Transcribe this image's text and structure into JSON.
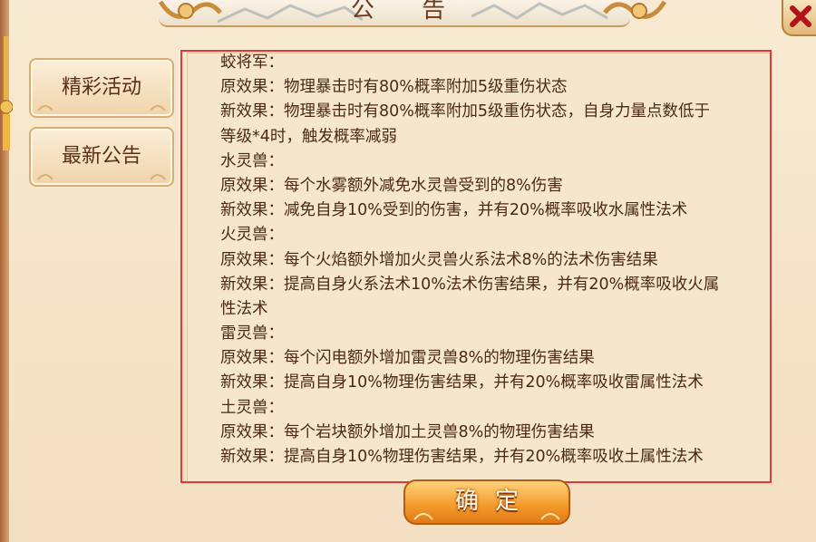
{
  "header": {
    "title": "公 告"
  },
  "close_button": {
    "icon": "close-icon"
  },
  "sidebar": {
    "tabs": [
      {
        "label": "精彩活动"
      },
      {
        "label": "最新公告"
      }
    ]
  },
  "announcement": {
    "lines": [
      "蛟将军：",
      "原效果：物理暴击时有80%概率附加5级重伤状态",
      "新效果：物理暴击时有80%概率附加5级重伤状态，自身力量点数低于",
      "等级*4时，触发概率减弱",
      "水灵兽：",
      "原效果：每个水雾额外减免水灵兽受到的8%伤害",
      "新效果：减免自身10%受到的伤害，并有20%概率吸收水属性法术",
      "火灵兽：",
      "原效果：每个火焰额外增加火灵兽火系法术8%的法术伤害结果",
      "新效果：提高自身火系法术10%法术伤害结果，并有20%概率吸收火属",
      "性法术",
      "雷灵兽：",
      "原效果：每个闪电额外增加雷灵兽8%的物理伤害结果",
      "新效果：提高自身10%物理伤害结果，并有20%概率吸收雷属性法术",
      "土灵兽：",
      "原效果：每个岩块额外增加土灵兽8%的物理伤害结果",
      "新效果：提高自身10%物理伤害结果，并有20%概率吸收土属性法术"
    ]
  },
  "confirm_button": {
    "label": "确定"
  },
  "colors": {
    "text": "#4a2a14",
    "accent": "#f39a2a",
    "highlight_outline": "#e0393b"
  }
}
